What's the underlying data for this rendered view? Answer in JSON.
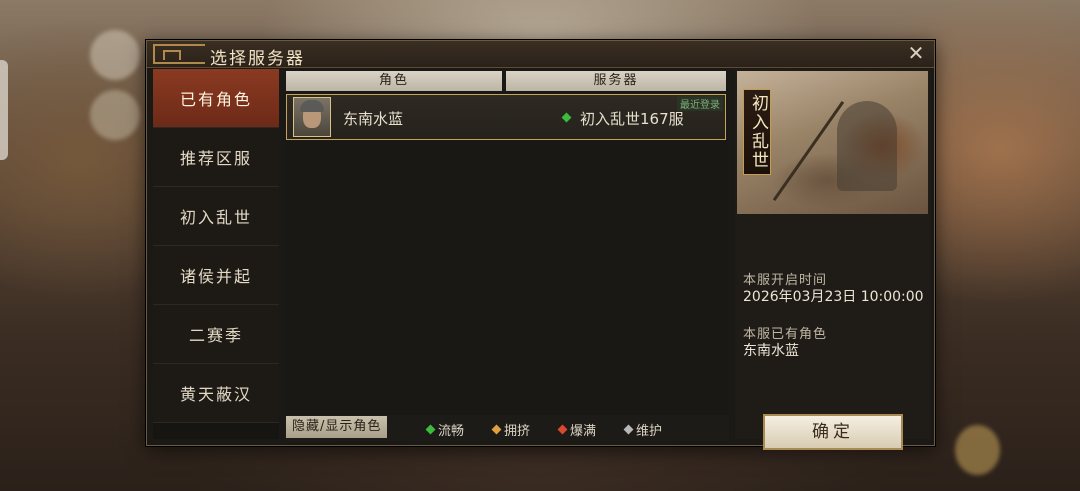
{
  "dialog": {
    "title": "选择服务器",
    "close_icon": "close-icon"
  },
  "nav": {
    "items": [
      {
        "label": "已有角色",
        "active": true
      },
      {
        "label": "推荐区服",
        "active": false
      },
      {
        "label": "初入乱世",
        "active": false
      },
      {
        "label": "诸侯并起",
        "active": false
      },
      {
        "label": "二赛季",
        "active": false
      },
      {
        "label": "黄天蔽汉",
        "active": false
      }
    ]
  },
  "table": {
    "headers": [
      "角色",
      "服务器"
    ],
    "rows": [
      {
        "avatar_icon": "character-portrait-icon",
        "name": "东南水蓝",
        "status_color": "#3dbb3d",
        "server": "初入乱世167服",
        "badge": "最近登录"
      }
    ]
  },
  "legend": {
    "toggle_label": "隐藏/显示角色",
    "items": [
      {
        "label": "流畅",
        "color": "#3dbb3d"
      },
      {
        "label": "拥挤",
        "color": "#e0a040"
      },
      {
        "label": "爆满",
        "color": "#d84a2e"
      },
      {
        "label": "维护",
        "color": "#b8b8b8"
      }
    ]
  },
  "server_info": {
    "banner_title": "初入乱世",
    "open_time_label": "本服开启时间",
    "open_time_value": "2026年03月23日  10:00:00",
    "existing_role_label": "本服已有角色",
    "existing_role_value": "东南水蓝",
    "confirm_label": "确定"
  }
}
